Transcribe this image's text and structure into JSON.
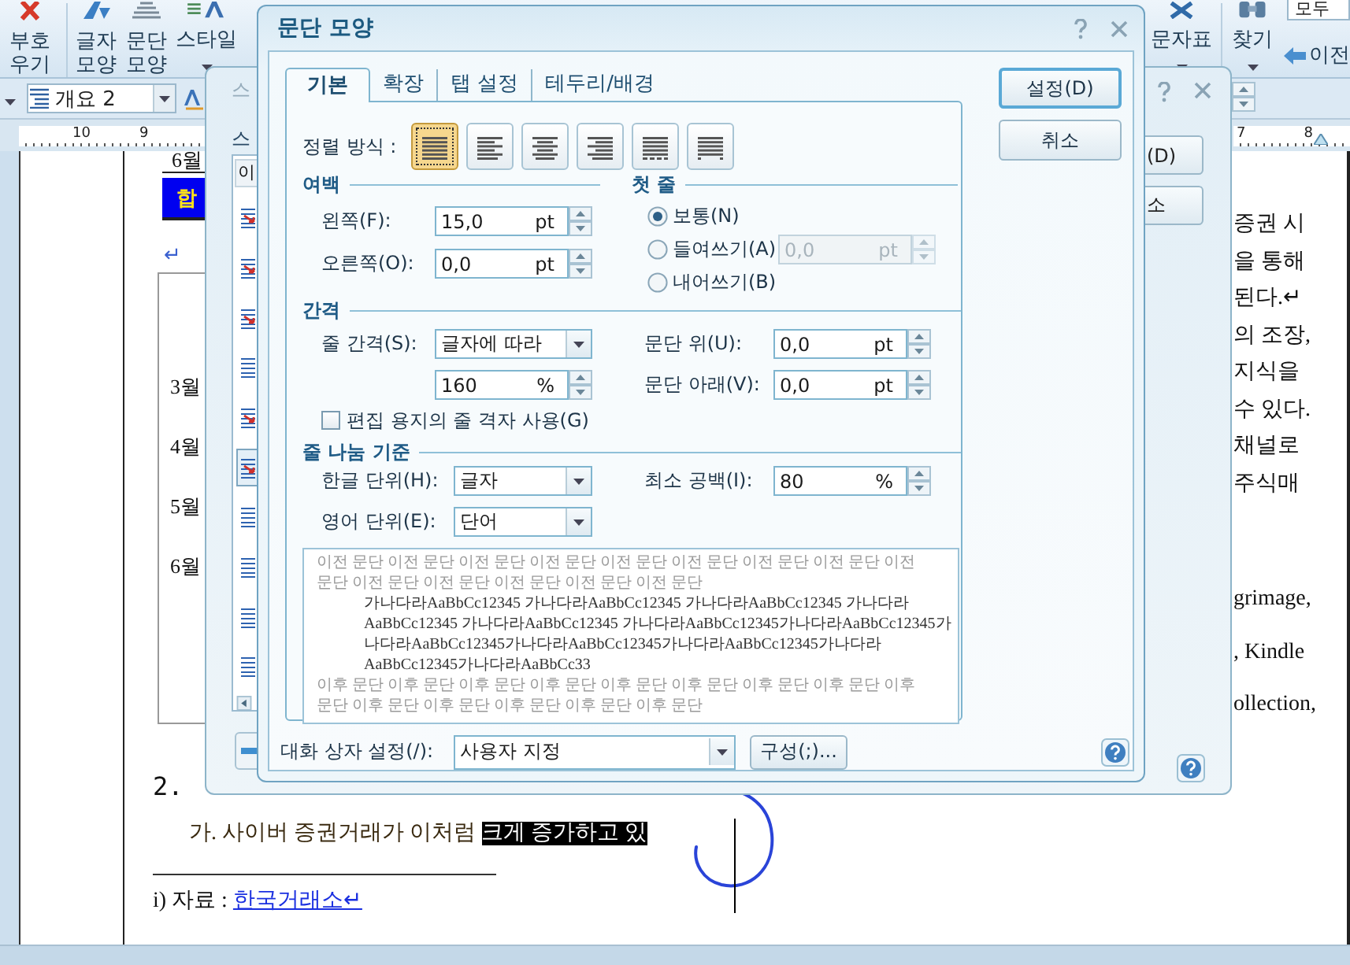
{
  "ribbon": {
    "left_items": [
      {
        "kind": "erase",
        "lines": [
          "부호",
          "우기"
        ],
        "has_menu": false
      },
      {
        "kind": "char_shape",
        "lines": [
          "글자",
          "모양"
        ],
        "has_menu": false
      },
      {
        "kind": "para_shape",
        "lines": [
          "문단",
          "모양"
        ],
        "has_menu": false
      },
      {
        "kind": "style",
        "lines": [
          "스타일"
        ],
        "has_menu": true
      }
    ],
    "right_items": [
      {
        "kind": "symbols",
        "lines": [
          "문자표"
        ],
        "has_menu": true
      },
      {
        "kind": "find",
        "lines": [
          "찾기"
        ],
        "has_menu": true
      }
    ],
    "find_value": "모두",
    "prev_button": "이전"
  },
  "format_bar": {
    "style_value": "개요 2"
  },
  "ruler": {
    "left_numbers": [
      "10",
      "9"
    ],
    "right_numbers": [
      "7",
      "8"
    ]
  },
  "document": {
    "top_cell": "6월",
    "banner": "합",
    "mark": "↵",
    "months": [
      "3월",
      "4월",
      "5월",
      "6월"
    ],
    "right_column": {
      "upper": [
        "증권 시",
        "을 통해",
        "된다.↵",
        "의 조장,",
        "지식을",
        "수 있다.",
        "채널로",
        "주식매"
      ],
      "lower": [
        "grimage,",
        ", Kindle",
        "ollection,"
      ]
    },
    "heading": "2.",
    "paragraph": {
      "text": "가. 사이버 증권거래가 이처럼 ",
      "highlighted": "크게 증가하고 있"
    },
    "footnote": {
      "label": "i) 자료 : ",
      "link": "한국거래소↵"
    }
  },
  "style_dialog": {
    "title": "스",
    "section_label": "스",
    "list_header": "이",
    "list_items": [
      {
        "kind": "character",
        "selected": false
      },
      {
        "kind": "character",
        "selected": false
      },
      {
        "kind": "character",
        "selected": false
      },
      {
        "kind": "paragraph",
        "selected": false
      },
      {
        "kind": "character",
        "selected": false
      },
      {
        "kind": "character",
        "selected": true
      },
      {
        "kind": "paragraph",
        "selected": false
      },
      {
        "kind": "paragraph",
        "selected": false
      },
      {
        "kind": "paragraph",
        "selected": false
      },
      {
        "kind": "paragraph",
        "selected": false
      }
    ],
    "buttons": [
      "(D)",
      "소"
    ]
  },
  "paragraph_dialog": {
    "title": "문단 모양",
    "tabs": [
      {
        "label": "기본",
        "selected": true
      },
      {
        "label": "확장",
        "selected": false
      },
      {
        "label": "탭 설정",
        "selected": false
      },
      {
        "label": "테두리/배경",
        "selected": false
      }
    ],
    "alignment": {
      "label": "정렬 방식 :",
      "options": [
        {
          "kind": "justify",
          "selected": true
        },
        {
          "kind": "left",
          "selected": false
        },
        {
          "kind": "center",
          "selected": false
        },
        {
          "kind": "right",
          "selected": false
        },
        {
          "kind": "distribute",
          "selected": false
        },
        {
          "kind": "divide",
          "selected": false
        }
      ]
    },
    "margins": {
      "title": "여백",
      "fields": [
        {
          "label": "왼쪽(F):",
          "value": "15,0",
          "unit": "pt"
        },
        {
          "label": "오른쪽(O):",
          "value": "0,0",
          "unit": "pt"
        }
      ]
    },
    "first_line": {
      "title": "첫 줄",
      "options": [
        {
          "label": "보통(N)",
          "selected": true
        },
        {
          "label": "들여쓰기(A)",
          "selected": false
        },
        {
          "label": "내어쓰기(B)",
          "selected": false
        }
      ],
      "indent": {
        "value": "0,0",
        "unit": "pt",
        "disabled": true
      }
    },
    "spacing": {
      "title": "간격",
      "line_spacing": {
        "label": "줄 간격(S):",
        "value": "글자에 따라"
      },
      "line_value": {
        "value": "160",
        "unit": "%"
      },
      "above": {
        "label": "문단 위(U):",
        "value": "0,0",
        "unit": "pt"
      },
      "below": {
        "label": "문단 아래(V):",
        "value": "0,0",
        "unit": "pt"
      },
      "grid_checkbox": {
        "label": "편집 용지의 줄 격자 사용(G)",
        "checked": false
      }
    },
    "line_break": {
      "title": "줄 나눔 기준",
      "korean": {
        "label": "한글 단위(H):",
        "value": "글자"
      },
      "english": {
        "label": "영어 단위(E):",
        "value": "단어"
      },
      "min_space": {
        "label": "최소 공백(I):",
        "value": "80",
        "unit": "%"
      }
    },
    "preview": {
      "before_lines": [
        "이전 문단 이전 문단 이전 문단 이전 문단 이전 문단 이전 문단 이전 문단 이전 문단 이전",
        "문단 이전 문단 이전 문단 이전 문단 이전 문단 이전 문단"
      ],
      "sample_lines": [
        "가나다라AaBbCc12345 가나다라AaBbCc12345 가나다라AaBbCc12345 가나다라",
        "AaBbCc12345 가나다라AaBbCc12345 가나다라AaBbCc12345가나다라AaBbCc12345가",
        "나다라AaBbCc12345가나다라AaBbCc12345가나다라AaBbCc12345가나다라",
        "AaBbCc12345가나다라AaBbCc33"
      ],
      "after_lines": [
        "이후 문단 이후 문단 이후 문단 이후 문단 이후 문단 이후 문단 이후 문단 이후 문단 이후",
        "문단 이후 문단 이후 문단 이후 문단 이후 문단 이후 문단"
      ]
    },
    "preset": {
      "label": "대화 상자 설정(/):",
      "value": "사용자 지정"
    },
    "configure_button": "구성(;)...",
    "buttons": [
      {
        "label": "설정(D)",
        "default": true
      },
      {
        "label": "취소",
        "default": false
      }
    ]
  }
}
